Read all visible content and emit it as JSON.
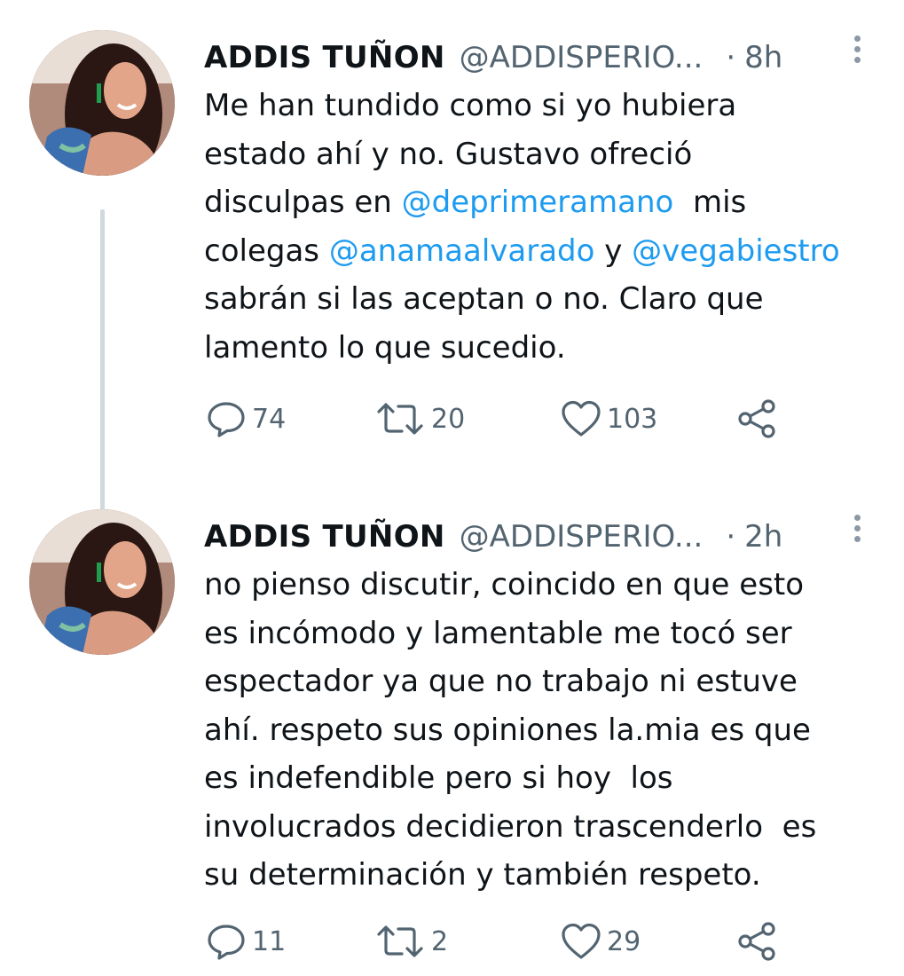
{
  "tweets": [
    {
      "display_name": "ADDIS TUÑON",
      "handle": "@ADDISPERIO...",
      "separator": "·",
      "time": "8h",
      "body_lines": [
        [
          {
            "text": "Me han tundido como si yo hubiera"
          }
        ],
        [
          {
            "text": "estado ahí y no. Gustavo ofreció"
          }
        ],
        [
          {
            "text": "disculpas en "
          },
          {
            "text": "@deprimeramano",
            "mention": true
          },
          {
            "text": "  mis"
          }
        ],
        [
          {
            "text": "colegas "
          },
          {
            "text": "@anamaalvarado",
            "mention": true
          },
          {
            "text": " y "
          },
          {
            "text": "@vegabiestro",
            "mention": true
          }
        ],
        [
          {
            "text": "sabrán si las aceptan o no. Claro que"
          }
        ],
        [
          {
            "text": "lamento lo que sucedio."
          }
        ]
      ],
      "replies": "74",
      "retweets": "20",
      "likes": "103",
      "icons": {
        "reply": "reply-icon",
        "retweet": "retweet-icon",
        "like": "heart-icon",
        "share": "share-icon",
        "more": "more-icon"
      }
    },
    {
      "display_name": "ADDIS TUÑON",
      "handle": "@ADDISPERIO...",
      "separator": "·",
      "time": "2h",
      "body_lines": [
        [
          {
            "text": "no pienso discutir, coincido en que esto"
          }
        ],
        [
          {
            "text": "es incómodo y lamentable me tocó ser"
          }
        ],
        [
          {
            "text": "espectador ya que no trabajo ni estuve"
          }
        ],
        [
          {
            "text": "ahí. respeto sus opiniones la.mia es que"
          }
        ],
        [
          {
            "text": "es indefendible pero si hoy  los"
          }
        ],
        [
          {
            "text": "involucrados decidieron trascenderlo  es"
          }
        ],
        [
          {
            "text": "su determinación y también respeto."
          }
        ]
      ],
      "replies": "11",
      "retweets": "2",
      "likes": "29",
      "icons": {
        "reply": "reply-icon",
        "retweet": "retweet-icon",
        "like": "heart-icon",
        "share": "share-icon",
        "more": "more-icon"
      }
    }
  ],
  "colors": {
    "text": "#0f1419",
    "secondary": "#536471",
    "mention": "#1d9bf0",
    "thread_line": "#cfd9de"
  }
}
